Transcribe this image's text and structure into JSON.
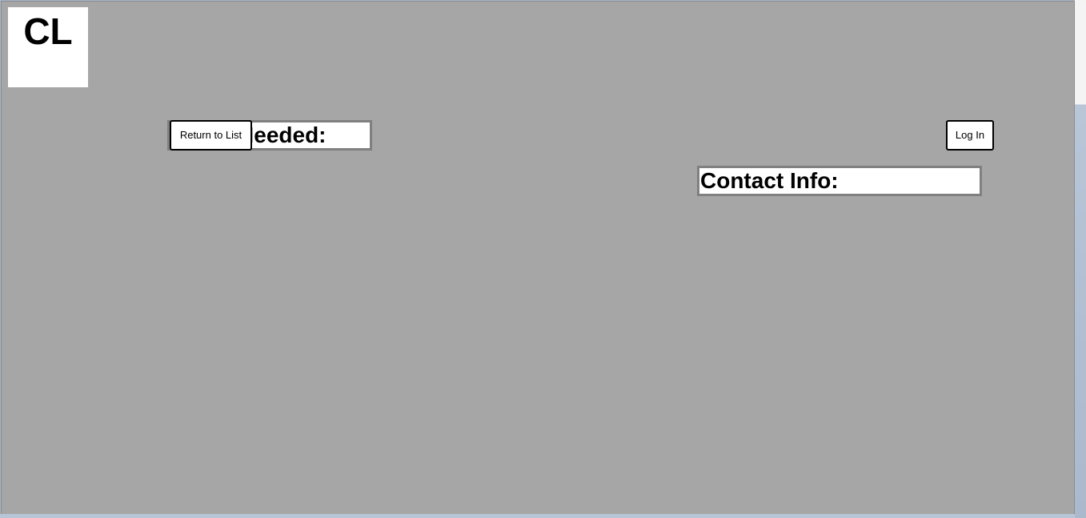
{
  "logo": {
    "text": "CL"
  },
  "name_field": {
    "label": "Name Needed:"
  },
  "contact_field": {
    "label": "Contact Info:"
  },
  "buttons": {
    "return_label": "Return to List",
    "login_label": "Log In"
  },
  "colors": {
    "page_background": "#a6a6a6",
    "box_background": "#ffffff",
    "box_border": "#808080",
    "button_border": "#000000"
  }
}
